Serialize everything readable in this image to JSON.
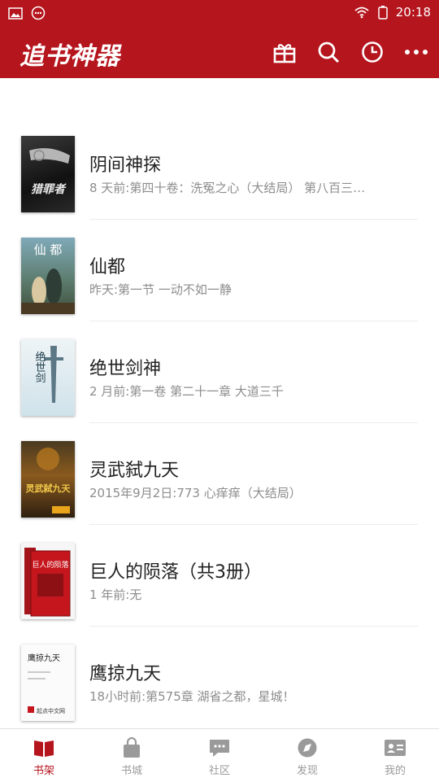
{
  "status_bar": {
    "time": "20:18",
    "icons": [
      "image-icon",
      "chat-icon",
      "wifi-icon",
      "battery-icon"
    ]
  },
  "app_bar": {
    "title": "追书神器",
    "actions": [
      "gift-icon",
      "search-icon",
      "history-icon",
      "more-icon"
    ]
  },
  "colors": {
    "brand": "#b5151d",
    "text": "#222222",
    "muted": "#8d8d8d"
  },
  "books": [
    {
      "title": "阴间神探",
      "subtitle": "8 天前:第四十卷：洗冤之心（大结局） 第八百三…"
    },
    {
      "title": "仙都",
      "subtitle": "昨天:第一节 一动不如一静"
    },
    {
      "title": "绝世剑神",
      "subtitle": "2 月前:第一卷 第二十一章 大道三千"
    },
    {
      "title": "灵武弑九天",
      "subtitle": "2015年9月2日:773 心痒痒（大结局）"
    },
    {
      "title": "巨人的陨落（共3册）",
      "subtitle": "1 年前:无"
    },
    {
      "title": "鹰掠九天",
      "subtitle": "18小时前:第575章 湖省之都，星城！"
    }
  ],
  "covers": {
    "c1": {
      "text": "猎罪者"
    },
    "c2": {
      "text": "仙 都"
    },
    "c3": {
      "text": "绝世剑"
    },
    "c4": {
      "text": "灵武弑九天"
    },
    "c5": {
      "text": "巨人的陨落"
    },
    "c6": {
      "text": "鹰掠九天",
      "tagline": "起点中文网"
    }
  },
  "tabs": [
    {
      "label": "书架",
      "icon": "bookshelf-icon",
      "active": true
    },
    {
      "label": "书城",
      "icon": "bag-icon",
      "active": false
    },
    {
      "label": "社区",
      "icon": "chat-bubble-icon",
      "active": false
    },
    {
      "label": "发现",
      "icon": "compass-icon",
      "active": false
    },
    {
      "label": "我的",
      "icon": "profile-card-icon",
      "active": false
    }
  ]
}
